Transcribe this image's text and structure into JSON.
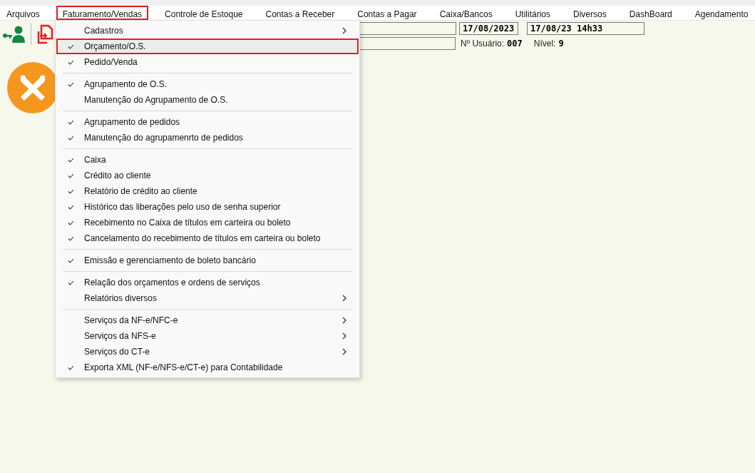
{
  "menubar": [
    {
      "label": "Arquivos",
      "highlighted": false
    },
    {
      "label": "Faturamento/Vendas",
      "highlighted": true
    },
    {
      "label": "Controle de Estoque",
      "highlighted": false
    },
    {
      "label": "Contas a Receber",
      "highlighted": false
    },
    {
      "label": "Contas a Pagar",
      "highlighted": false
    },
    {
      "label": "Caixa/Bancos",
      "highlighted": false
    },
    {
      "label": "Utilitários",
      "highlighted": false
    },
    {
      "label": "Diversos",
      "highlighted": false
    },
    {
      "label": "DashBoard",
      "highlighted": false
    },
    {
      "label": "Agendamento",
      "highlighted": false
    }
  ],
  "header": {
    "date": "17/08/2023",
    "datetime": "17/08/23 14h33",
    "user_label": "Nº Usuário:",
    "user_value": "007",
    "level_label": "Nível:",
    "level_value": "9"
  },
  "dropdown": {
    "groups": [
      [
        {
          "label": "Cadastros",
          "checked": false,
          "submenu": true,
          "highlighted": false
        },
        {
          "label": "Orçamento/O.S.",
          "checked": true,
          "submenu": false,
          "highlighted": true
        },
        {
          "label": "Pedido/Venda",
          "checked": true,
          "submenu": false,
          "highlighted": false
        }
      ],
      [
        {
          "label": "Agrupamento de O.S.",
          "checked": true,
          "submenu": false,
          "highlighted": false
        },
        {
          "label": "Manutenção do Agrupamento de O.S.",
          "checked": false,
          "submenu": false,
          "highlighted": false
        }
      ],
      [
        {
          "label": "Agrupamento de pedidos",
          "checked": true,
          "submenu": false,
          "highlighted": false
        },
        {
          "label": "Manutenção do agrupamenrto de pedidos",
          "checked": true,
          "submenu": false,
          "highlighted": false
        }
      ],
      [
        {
          "label": "Caixa",
          "checked": true,
          "submenu": false,
          "highlighted": false
        },
        {
          "label": "Crédito ao cliente",
          "checked": true,
          "submenu": false,
          "highlighted": false
        },
        {
          "label": "Relatório de crédito ao cliente",
          "checked": true,
          "submenu": false,
          "highlighted": false
        },
        {
          "label": "Histórico das liberações pelo uso de senha superior",
          "checked": true,
          "submenu": false,
          "highlighted": false
        },
        {
          "label": "Recebimento no Caixa de títulos em carteira ou boleto",
          "checked": true,
          "submenu": false,
          "highlighted": false
        },
        {
          "label": "Cancelamento do recebimento de títulos em carteira ou boleto",
          "checked": true,
          "submenu": false,
          "highlighted": false
        }
      ],
      [
        {
          "label": "Emissão e gerenciamento de boleto bancário",
          "checked": true,
          "submenu": false,
          "highlighted": false
        }
      ],
      [
        {
          "label": "Relação dos orçamentos e ordens de serviços",
          "checked": true,
          "submenu": false,
          "highlighted": false
        },
        {
          "label": "Relatórios diversos",
          "checked": false,
          "submenu": true,
          "highlighted": false
        }
      ],
      [
        {
          "label": "Serviços da NF-e/NFC-e",
          "checked": false,
          "submenu": true,
          "highlighted": false
        },
        {
          "label": "Serviços da NFS-e",
          "checked": false,
          "submenu": true,
          "highlighted": false
        },
        {
          "label": "Serviços do CT-e",
          "checked": false,
          "submenu": true,
          "highlighted": false
        },
        {
          "label": "Exporta XML (NF-e/NFS-e/CT-e) para Contabilidade",
          "checked": true,
          "submenu": false,
          "highlighted": false
        }
      ]
    ]
  }
}
